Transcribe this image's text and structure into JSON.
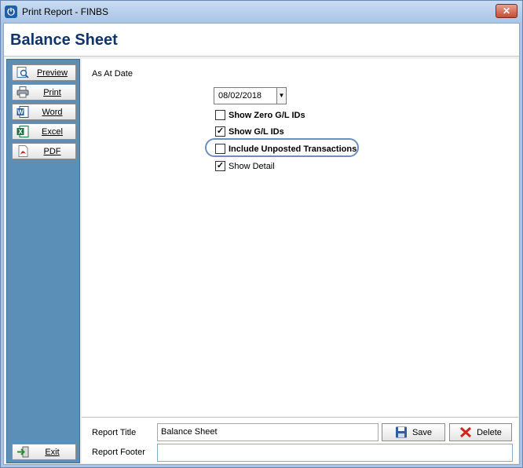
{
  "window": {
    "title": "Print Report - FINBS",
    "close_glyph": "✕"
  },
  "page": {
    "title": "Balance Sheet"
  },
  "sidebar": {
    "items": [
      {
        "label": "Preview",
        "icon": "preview-icon"
      },
      {
        "label": "Print",
        "icon": "printer-icon"
      },
      {
        "label": "Word",
        "icon": "word-icon"
      },
      {
        "label": "Excel",
        "icon": "excel-icon"
      },
      {
        "label": "PDF",
        "icon": "pdf-icon"
      }
    ],
    "exit_label": "Exit"
  },
  "form": {
    "as_at_label": "As At Date",
    "as_at_value": "08/02/2018",
    "options": [
      {
        "label": "Show Zero G/L IDs",
        "checked": false,
        "bold": true
      },
      {
        "label": "Show G/L IDs",
        "checked": true,
        "bold": true
      },
      {
        "label": "Include Unposted Transactions",
        "checked": false,
        "bold": true,
        "highlighted": true
      },
      {
        "label": "Show Detail",
        "checked": true,
        "bold": false
      }
    ]
  },
  "footer": {
    "report_title_label": "Report Title",
    "report_title_value": "Balance Sheet",
    "report_footer_label": "Report Footer",
    "report_footer_value": "",
    "save_label": "Save",
    "delete_label": "Delete"
  },
  "colors": {
    "sidebar_bg": "#5b8fb8",
    "title_color": "#10356b",
    "highlight_ring": "#6d8fc0"
  }
}
